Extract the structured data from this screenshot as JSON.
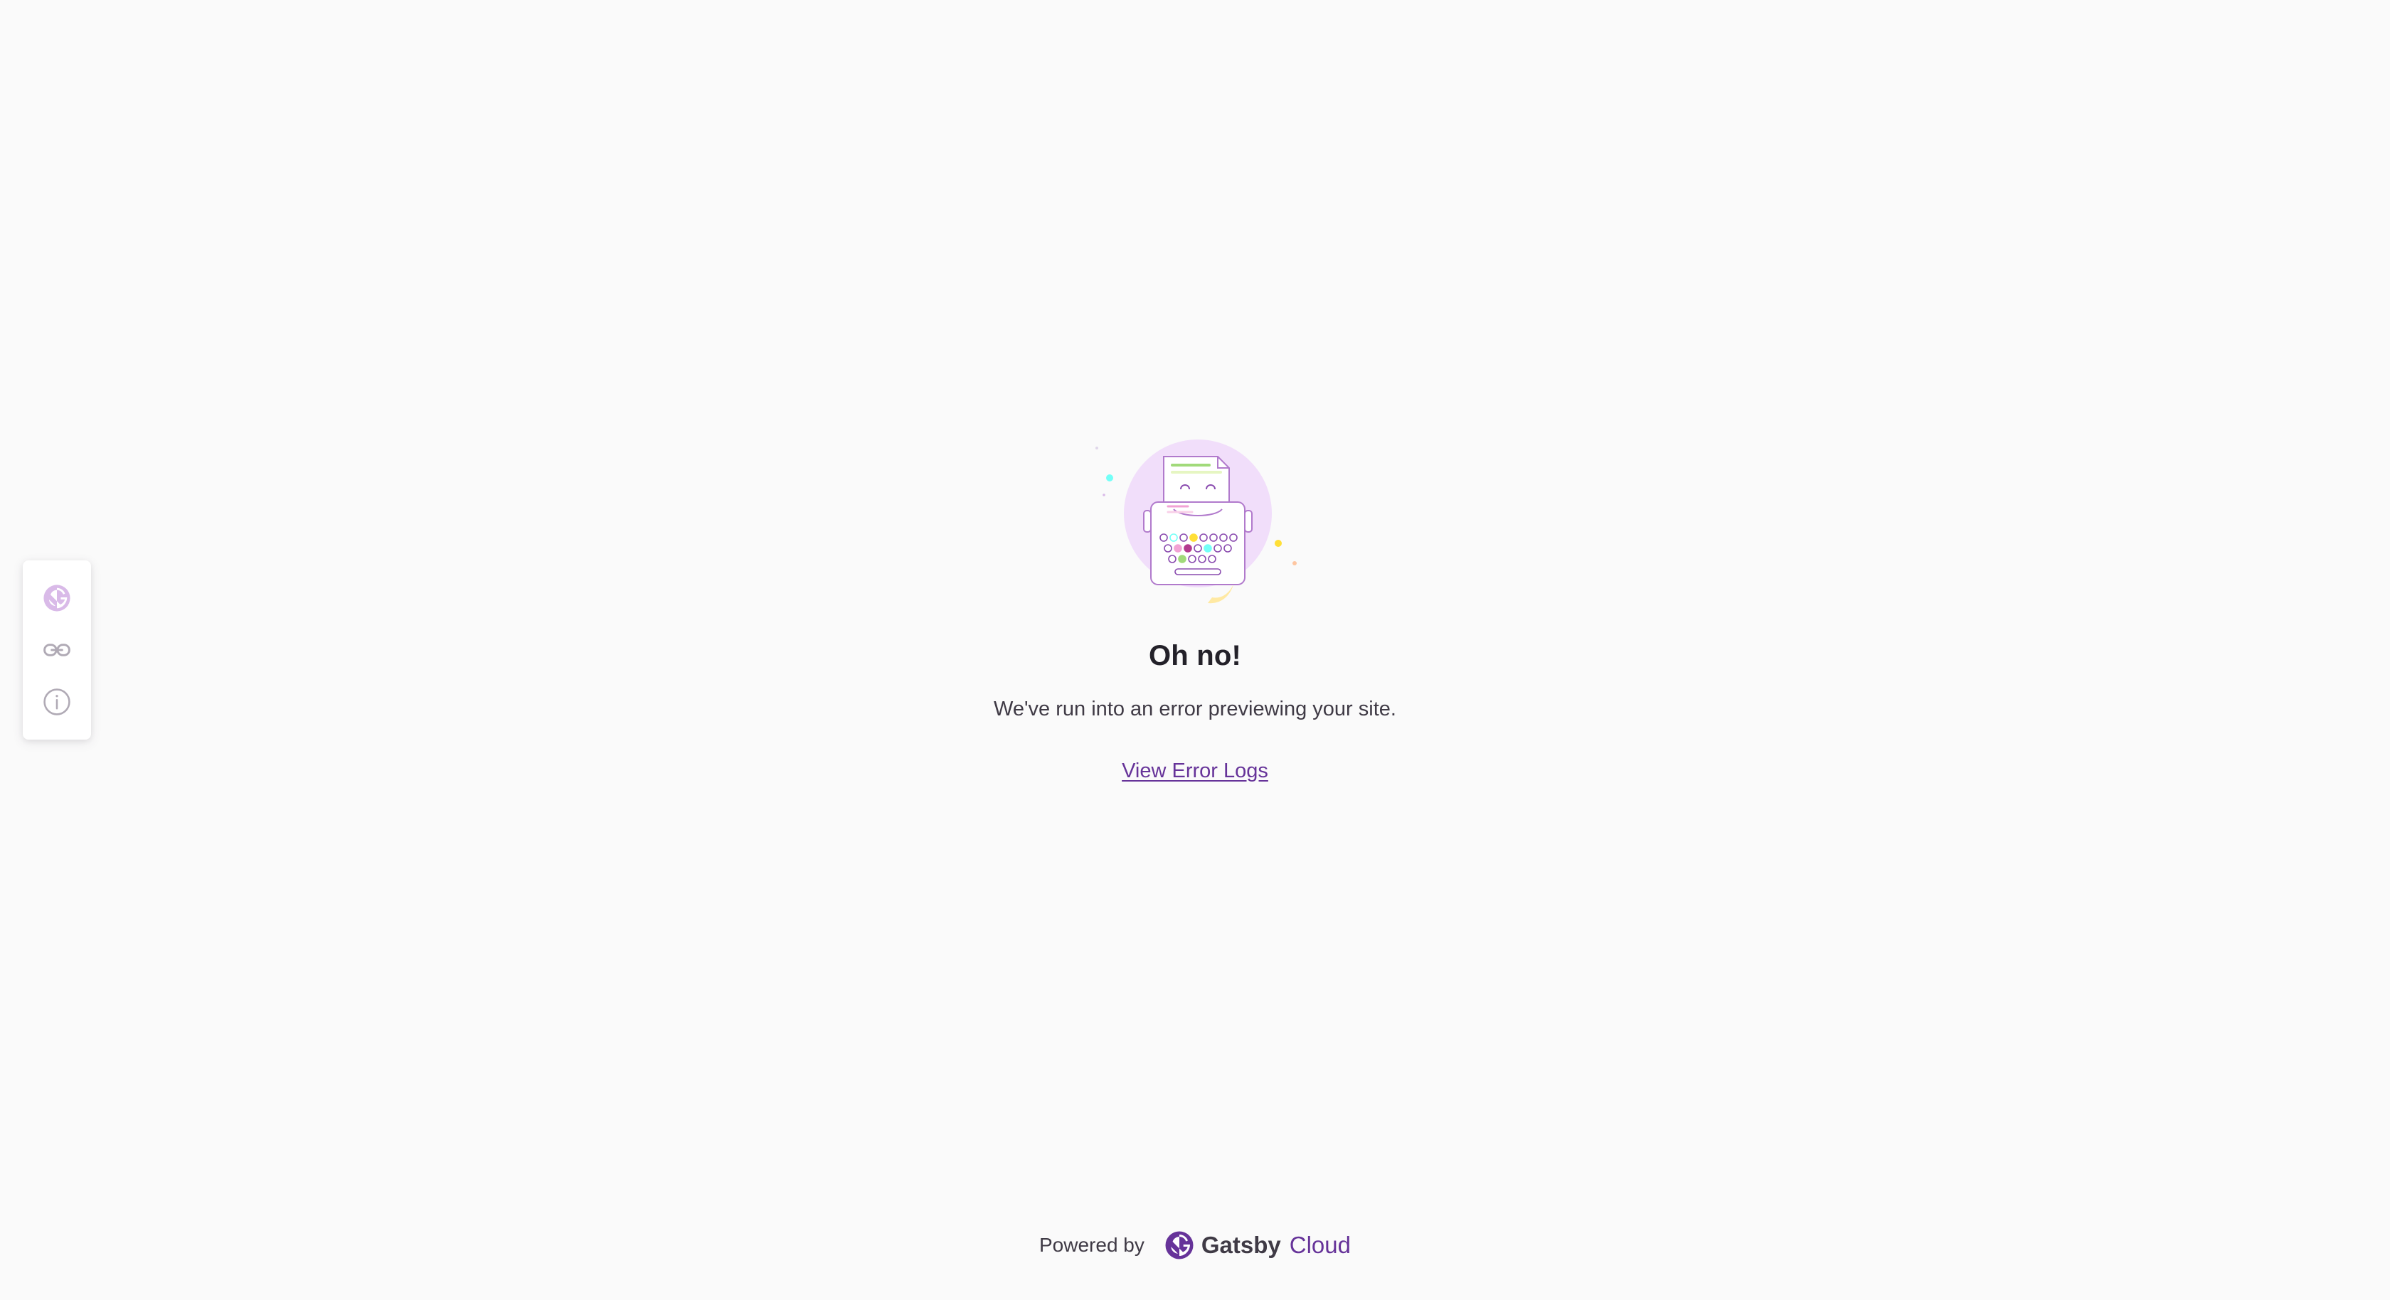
{
  "indicator": {
    "items": [
      {
        "name": "gatsby-logo-icon"
      },
      {
        "name": "link-icon"
      },
      {
        "name": "info-icon"
      }
    ]
  },
  "main": {
    "illustration_icon": "typewriter-illustration",
    "title": "Oh no!",
    "message": "We've run into an error previewing your site.",
    "link_label": "View Error Logs"
  },
  "footer": {
    "powered_by": "Powered by",
    "brand_name": "Gatsby",
    "brand_suffix": "Cloud"
  },
  "colors": {
    "accent": "#663399",
    "background": "#fafafa",
    "text": "#232129"
  }
}
